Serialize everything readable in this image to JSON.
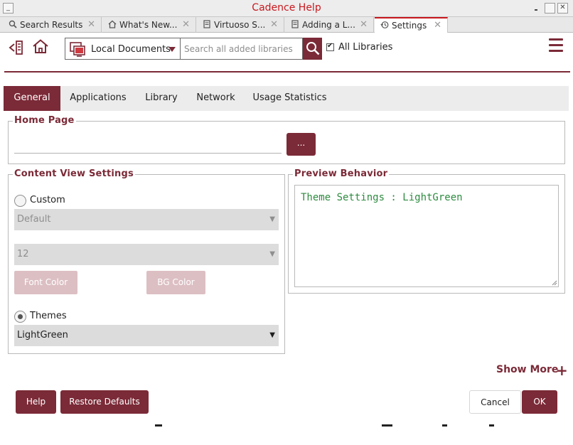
{
  "window": {
    "title": "Cadence Help",
    "controls": {
      "minimize": "_",
      "maximize": "□",
      "close": "✕"
    }
  },
  "tabs": [
    {
      "label": "Search Results",
      "icon": "search-icon",
      "active": false
    },
    {
      "label": "What's New...",
      "icon": "home-icon",
      "active": false
    },
    {
      "label": "Virtuoso S...",
      "icon": "document-icon",
      "active": false
    },
    {
      "label": "Adding a L...",
      "icon": "document-icon",
      "active": false
    },
    {
      "label": "Settings",
      "icon": "history-icon",
      "active": true
    }
  ],
  "toolbar": {
    "doc_source_label": "Local Documents",
    "search_placeholder": "Search all added libraries",
    "all_libraries_label": "All Libraries",
    "all_libraries_checked": true
  },
  "settings_tabs": [
    "General",
    "Applications",
    "Library",
    "Network",
    "Usage Statistics"
  ],
  "active_settings_tab": "General",
  "home_page": {
    "title": "Home Page",
    "value": "",
    "browse_label": "..."
  },
  "content_view": {
    "title": "Content View Settings",
    "custom_label": "Custom",
    "custom_selected": false,
    "font_value": "Default",
    "size_value": "12",
    "font_color_label": "Font Color",
    "bg_color_label": "BG Color",
    "themes_label": "Themes",
    "themes_selected": true,
    "theme_value": "LightGreen"
  },
  "preview": {
    "title": "Preview Behavior",
    "text": "Theme Settings : LightGreen"
  },
  "show_more_label": "Show More",
  "buttons": {
    "help": "Help",
    "restore_defaults": "Restore Defaults",
    "cancel": "Cancel",
    "ok": "OK"
  },
  "colors": {
    "accent": "#7b2a37",
    "title_red": "#c8181e",
    "preview_text": "#2e8b40",
    "disabled_button": "#dcbfc3"
  }
}
